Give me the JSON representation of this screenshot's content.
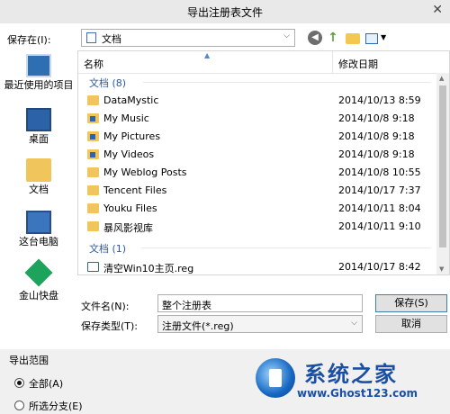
{
  "window": {
    "title": "导出注册表文件"
  },
  "savein": {
    "label": "保存在(I):",
    "value": "文档"
  },
  "places": [
    {
      "label": "最近使用的项目"
    },
    {
      "label": "桌面"
    },
    {
      "label": "文档"
    },
    {
      "label": "这台电脑"
    },
    {
      "label": "金山快盘"
    }
  ],
  "columns": {
    "name": "名称",
    "date": "修改日期"
  },
  "groups": [
    {
      "label": "文档 (8)",
      "items": [
        {
          "name": "DataMystic",
          "date": "2014/10/13 8:59",
          "icon": "folder-icon"
        },
        {
          "name": "My Music",
          "date": "2014/10/8 9:18",
          "icon": "special-folder-icon"
        },
        {
          "name": "My Pictures",
          "date": "2014/10/8 9:18",
          "icon": "special-folder-icon"
        },
        {
          "name": "My Videos",
          "date": "2014/10/8 9:18",
          "icon": "special-folder-icon"
        },
        {
          "name": "My Weblog Posts",
          "date": "2014/10/8 10:55",
          "icon": "folder-icon"
        },
        {
          "name": "Tencent Files",
          "date": "2014/10/17 7:37",
          "icon": "folder-icon"
        },
        {
          "name": "Youku Files",
          "date": "2014/10/11 8:04",
          "icon": "folder-icon"
        },
        {
          "name": "暴风影视库",
          "date": "2014/10/11 9:10",
          "icon": "folder-icon"
        }
      ]
    },
    {
      "label": "文档 (1)",
      "items": [
        {
          "name": "清空Win10主页.reg",
          "date": "2014/10/17 8:42",
          "icon": "reg-file-icon"
        }
      ]
    }
  ],
  "filename": {
    "label": "文件名(N):",
    "value": "整个注册表"
  },
  "filetype": {
    "label": "保存类型(T):",
    "value": "注册文件(*.reg)"
  },
  "buttons": {
    "save": "保存(S)",
    "cancel": "取消"
  },
  "export": {
    "title": "导出范围",
    "options": [
      {
        "label": "全部(A)",
        "selected": true
      },
      {
        "label": "所选分支(E)",
        "selected": false
      }
    ]
  },
  "watermark": {
    "line1": "系统之家",
    "line2": "www.Ghost123.com"
  }
}
